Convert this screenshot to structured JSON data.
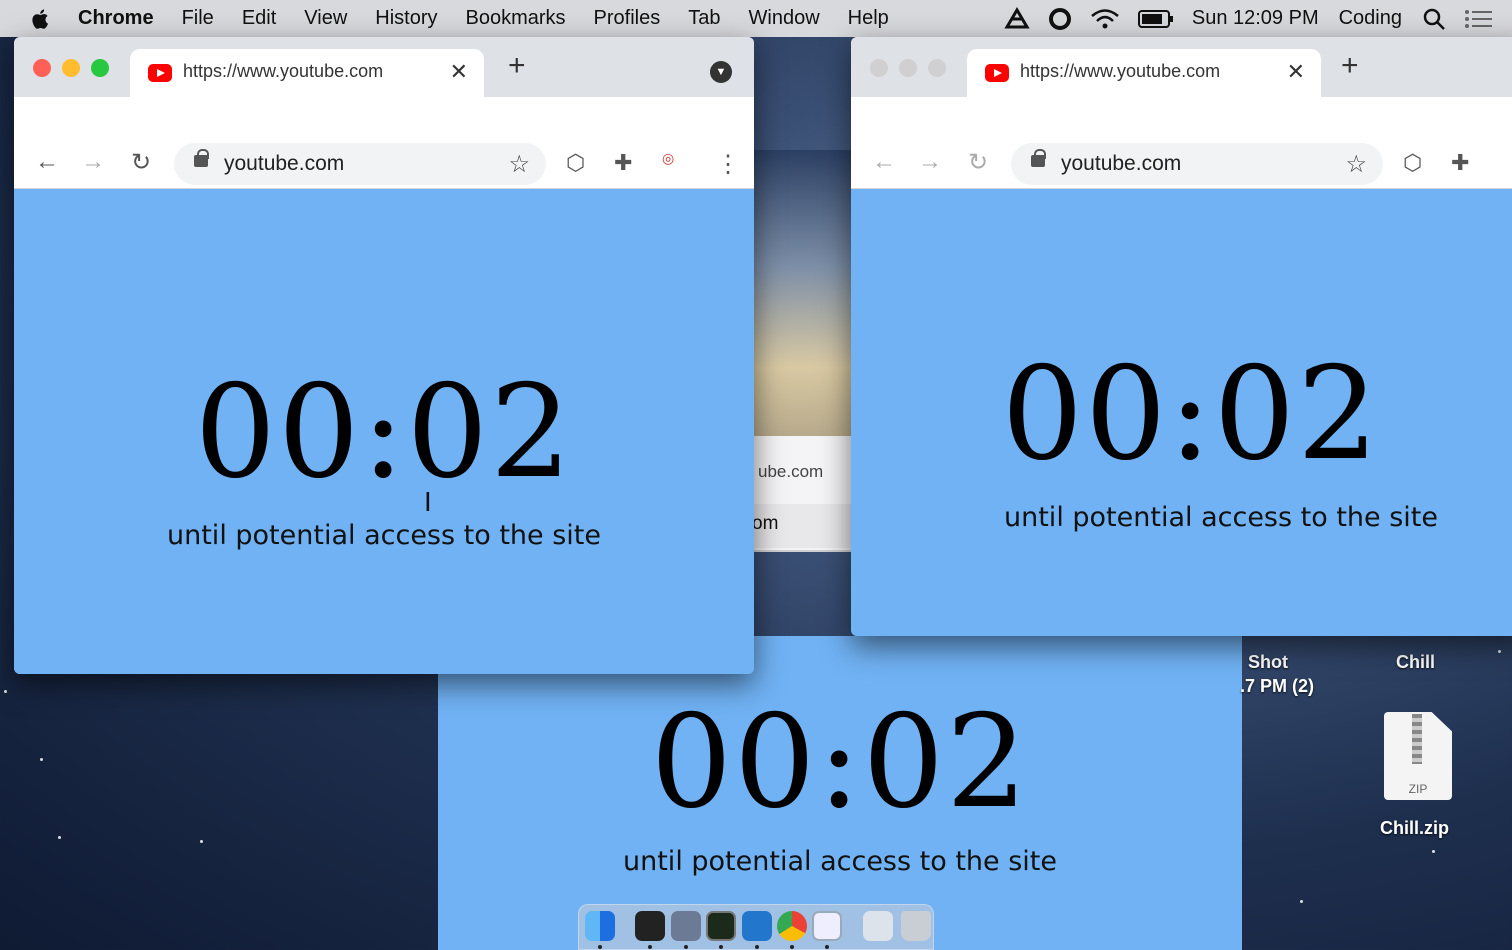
{
  "menubar": {
    "items": [
      "Chrome",
      "File",
      "Edit",
      "View",
      "History",
      "Bookmarks",
      "Profiles",
      "Tab",
      "Window",
      "Help"
    ],
    "clock": "Sun 12:09 PM",
    "user": "Coding"
  },
  "window_left": {
    "tab_title": "https://www.youtube.com",
    "url": "youtube.com",
    "timer": "00:02",
    "subtitle": "until potential access to the site"
  },
  "window_right": {
    "tab_title": "https://www.youtube.com",
    "url": "youtube.com",
    "timer": "00:02",
    "subtitle": "until potential access to the site"
  },
  "window_bottom": {
    "timer": "00:02",
    "subtitle": "until potential access to the site"
  },
  "under_window": {
    "row1": "ube.com",
    "row2": "om"
  },
  "desktop": {
    "screenshot_label_line1": "Shot",
    "screenshot_label_line2": ".7 PM (2)",
    "chill_folder": "Chill",
    "chill_zip": "Chill.zip",
    "zip_badge": "ZIP"
  },
  "colors": {
    "page_bg": "#70b2f4",
    "close": "#fe5f57",
    "minimize": "#febc2e",
    "maximize": "#28c840",
    "inactive_light": "#d0d0d2"
  }
}
